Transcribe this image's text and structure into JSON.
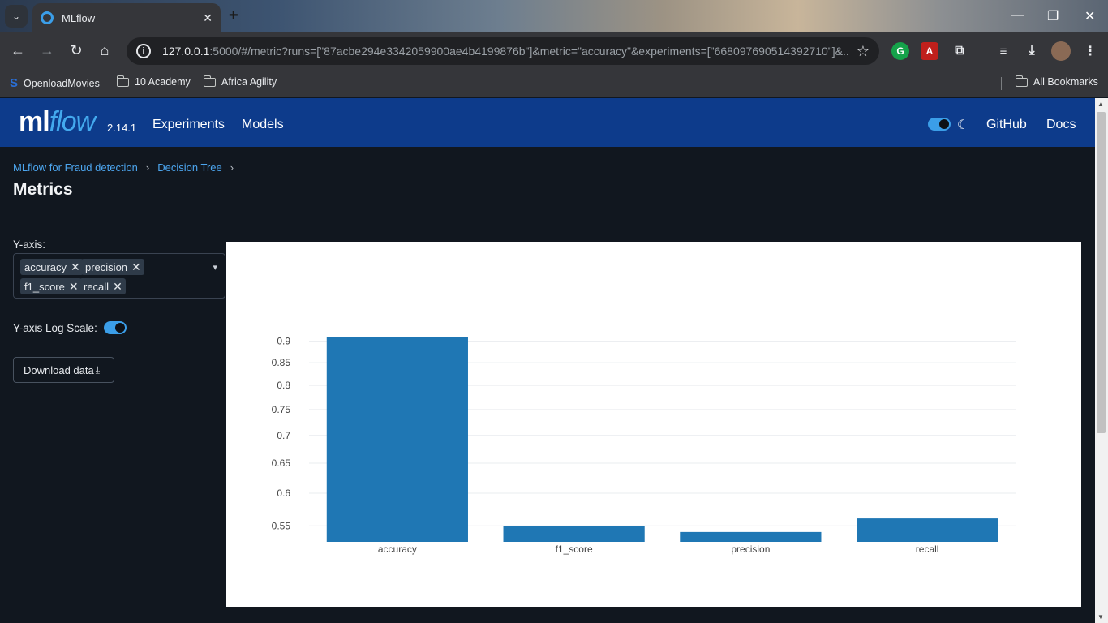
{
  "browser": {
    "tab_title": "MLflow",
    "url_host": "127.0.0.1",
    "url_rest": ":5000/#/metric?runs=[\"87acbe294e3342059900ae4b4199876b\"]&metric=\"accuracy\"&experiments=[\"668097690514392710\"]&...",
    "bookmarks": [
      "OpenloadMovies",
      "10 Academy",
      "Africa Agility"
    ],
    "all_bookmarks": "All Bookmarks"
  },
  "header": {
    "logo_ml": "ml",
    "logo_flow": "flow",
    "version": "2.14.1",
    "nav": [
      "Experiments",
      "Models"
    ],
    "links": [
      "GitHub",
      "Docs"
    ],
    "dark_mode": true
  },
  "breadcrumb": [
    "MLflow for Fraud detection",
    "Decision Tree"
  ],
  "page_title": "Metrics",
  "controls": {
    "yaxis_label": "Y-axis:",
    "selected_metrics": [
      "accuracy",
      "precision",
      "f1_score",
      "recall"
    ],
    "log_scale_label": "Y-axis Log Scale:",
    "log_scale_on": true,
    "download_label": "Download data"
  },
  "chart_data": {
    "type": "bar",
    "categories": [
      "accuracy",
      "f1_score",
      "precision",
      "recall"
    ],
    "values": [
      0.911,
      0.55,
      0.541,
      0.561
    ],
    "y_scale": "log",
    "ylim": [
      0.527,
      0.925
    ],
    "yticks": [
      0.55,
      0.6,
      0.65,
      0.7,
      0.75,
      0.8,
      0.85,
      0.9
    ],
    "bar_color": "#1f77b4",
    "grid": true
  }
}
